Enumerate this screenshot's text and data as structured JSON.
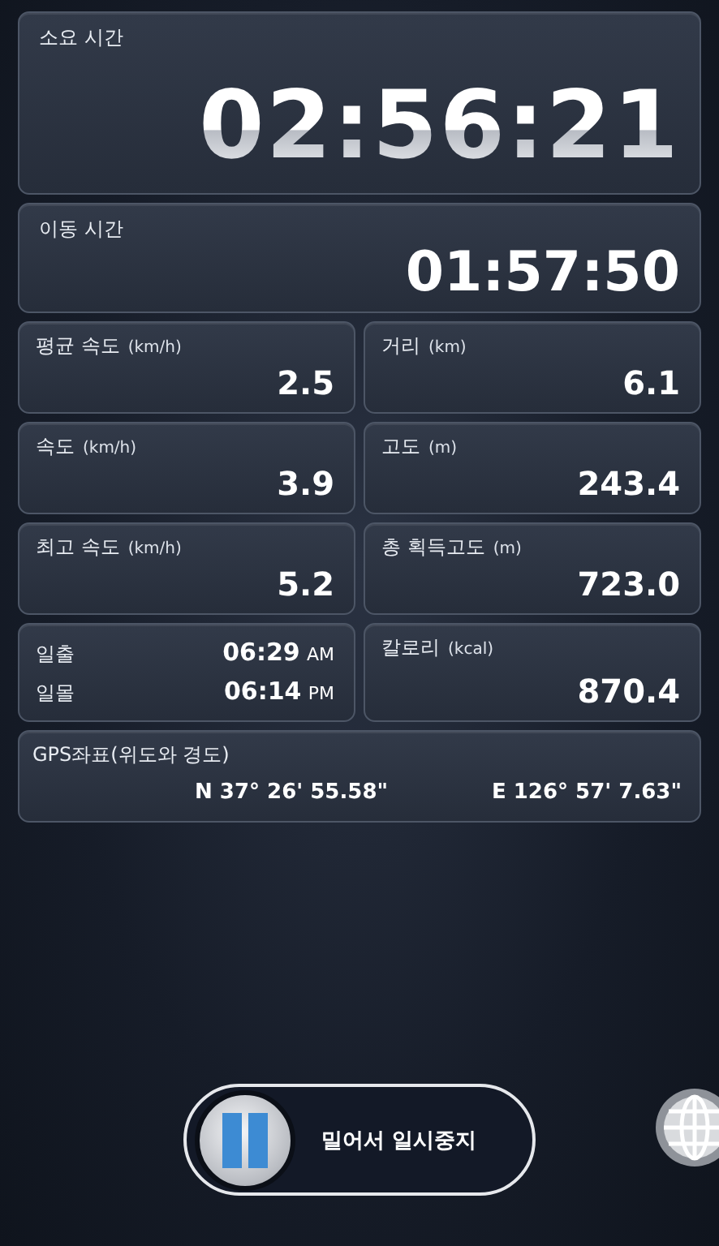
{
  "elapsed": {
    "label": "소요 시간",
    "value": "02:56:21"
  },
  "moving": {
    "label": "이동 시간",
    "value": "01:57:50"
  },
  "tiles": [
    {
      "kind": "stat",
      "label": "평균 속도",
      "unit": "(km/h)",
      "value": "2.5"
    },
    {
      "kind": "stat",
      "label": "거리",
      "unit": "(km)",
      "value": "6.1"
    },
    {
      "kind": "stat",
      "label": "속도",
      "unit": "(km/h)",
      "value": "3.9"
    },
    {
      "kind": "stat",
      "label": "고도",
      "unit": "(m)",
      "value": "243.4"
    },
    {
      "kind": "stat",
      "label": "최고 속도",
      "unit": "(km/h)",
      "value": "5.2"
    },
    {
      "kind": "stat",
      "label": "총 획득고도",
      "unit": "(m)",
      "value": "723.0"
    },
    {
      "kind": "sun",
      "rows": [
        {
          "label": "일출",
          "time": "06:29",
          "ampm": "AM"
        },
        {
          "label": "일몰",
          "time": "06:14",
          "ampm": "PM"
        }
      ]
    },
    {
      "kind": "stat",
      "label": "칼로리",
      "unit": "(kcal)",
      "value": "870.4"
    }
  ],
  "gps": {
    "label": "GPS좌표(위도와 경도)",
    "latitude": "N 37° 26' 55.58\"",
    "longitude": "E 126° 57' 7.63\""
  },
  "pause_slider": {
    "label": "밀어서 일시중지",
    "level": 0
  }
}
